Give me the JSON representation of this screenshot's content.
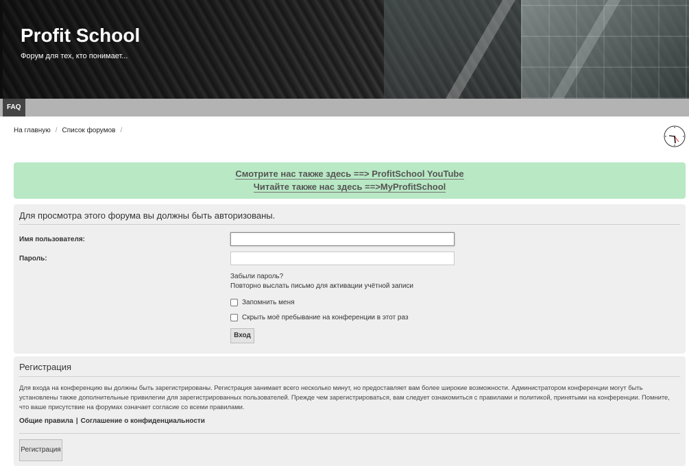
{
  "header": {
    "title": "Profit School",
    "description": "Форум для тех, кто понимает..."
  },
  "navbar": {
    "faq": "FAQ"
  },
  "breadcrumbs": [
    {
      "label": "На главную"
    },
    {
      "label": "Список форумов"
    }
  ],
  "announcement": {
    "line1": "Смотрите нас также здесь ==> ProfitSchool YouTube",
    "line2": "Читайте также нас здесь ==>MyProfitSchool",
    "background": "#b8e8c4"
  },
  "login": {
    "title": "Для просмотра этого форума вы должны быть авторизованы.",
    "username_label": "Имя пользователя:",
    "username_value": "",
    "password_label": "Пароль:",
    "password_value": "",
    "forgot_password": "Забыли пароль?",
    "resend_activation": "Повторно выслать письмо для активации учётной записи",
    "remember_me": "Запомнить меня",
    "hide_online": "Скрыть моё пребывание на конференции в этот раз",
    "submit": "Вход"
  },
  "registration": {
    "title": "Регистрация",
    "text": "Для входа на конференцию вы должны быть зарегистрированы. Регистрация занимает всего несколько минут, но предоставляет вам более широкие возможности. Администратором конференции могут быть установлены также дополнительные привилегии для зарегистрированных пользователей. Прежде чем зарегистрироваться, вам следует ознакомиться с правилами и политикой, принятыми на конференции. Помните, что ваше присутствие на форумах означает согласие со всеми правилами.",
    "rules_link": "Общие правила",
    "separator": "|",
    "privacy_link": "Соглашение о конфиденциальности",
    "button": "Регистрация"
  },
  "icons": {
    "clock": "clock-icon"
  }
}
